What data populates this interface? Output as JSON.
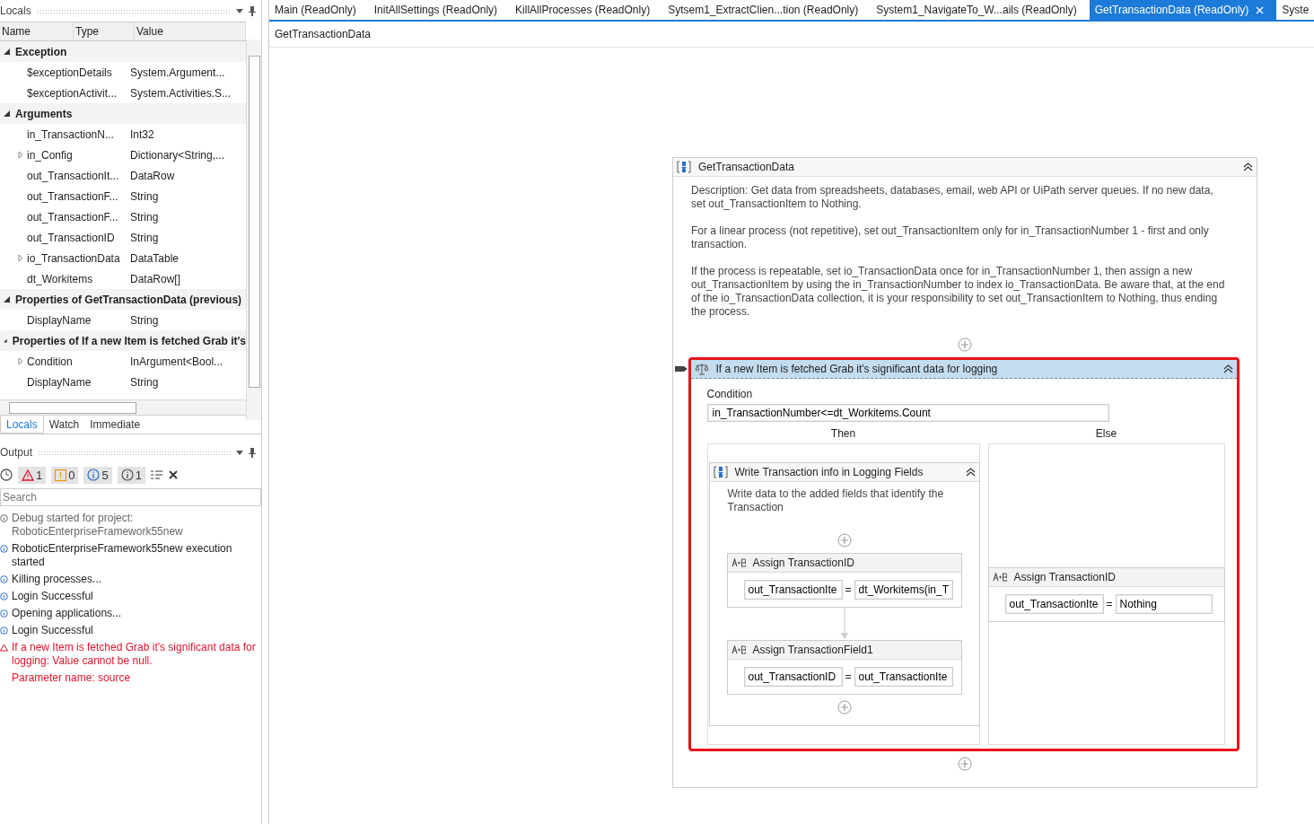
{
  "locals": {
    "title": "Locals",
    "columns": [
      "Name",
      "Type",
      "Value"
    ],
    "rows": [
      {
        "kind": "group",
        "label": "Exception",
        "expanded": true
      },
      {
        "kind": "item",
        "name": "$exceptionDetails",
        "value": "System.Argument..."
      },
      {
        "kind": "item",
        "name": "$exceptionActivit...",
        "value": "System.Activities.S..."
      },
      {
        "kind": "group",
        "label": "Arguments",
        "expanded": true
      },
      {
        "kind": "item",
        "name": "in_TransactionN...",
        "value": "Int32"
      },
      {
        "kind": "item",
        "name": "in_Config",
        "value": "Dictionary<String,...",
        "expanded": false
      },
      {
        "kind": "item",
        "name": "out_TransactionIt...",
        "value": "DataRow"
      },
      {
        "kind": "item",
        "name": "out_TransactionF...",
        "value": "String"
      },
      {
        "kind": "item",
        "name": "out_TransactionF...",
        "value": "String"
      },
      {
        "kind": "item",
        "name": "out_TransactionID",
        "value": "String"
      },
      {
        "kind": "item",
        "name": "io_TransactionData",
        "value": "DataTable",
        "expanded": false
      },
      {
        "kind": "item",
        "name": "dt_Workitems",
        "value": "DataRow[]"
      },
      {
        "kind": "group",
        "label": "Properties of GetTransactionData (previous)",
        "expanded": true
      },
      {
        "kind": "item",
        "name": "DisplayName",
        "value": "String"
      },
      {
        "kind": "group",
        "label": "Properties of If a new Item is fetched Grab it's",
        "expanded": true
      },
      {
        "kind": "item",
        "name": "Condition",
        "value": "InArgument<Bool...",
        "expanded": false
      },
      {
        "kind": "item",
        "name": "DisplayName",
        "value": "String"
      }
    ],
    "tabs": [
      {
        "label": "Locals",
        "selected": true
      },
      {
        "label": "Watch",
        "selected": false
      },
      {
        "label": "Immediate",
        "selected": false
      }
    ]
  },
  "output": {
    "title": "Output",
    "filters": [
      {
        "kind": "error",
        "count": "1",
        "selected": true
      },
      {
        "kind": "warning",
        "count": "0",
        "selected": true
      },
      {
        "kind": "info",
        "count": "5",
        "selected": true
      },
      {
        "kind": "trace",
        "count": "1",
        "selected": true
      }
    ],
    "search": {
      "placeholder": "Search"
    },
    "entries": [
      {
        "kind": "trace",
        "text": "Debug started for project: RoboticEnterpriseFramework55new"
      },
      {
        "kind": "info",
        "text": "RoboticEnterpriseFramework55new execution started"
      },
      {
        "kind": "info",
        "text": "Killing processes..."
      },
      {
        "kind": "info",
        "text": "Login Successful"
      },
      {
        "kind": "info",
        "text": "Opening applications..."
      },
      {
        "kind": "info",
        "text": "Login Successful"
      },
      {
        "kind": "error",
        "text": "If a new Item is fetched Grab it's significant data for logging: Value cannot be null.",
        "detail": "Parameter name: source"
      }
    ]
  },
  "doc_tabs": [
    {
      "label": "Main (ReadOnly)",
      "selected": false
    },
    {
      "label": "InitAllSettings (ReadOnly)",
      "selected": false
    },
    {
      "label": "KillAllProcesses (ReadOnly)",
      "selected": false
    },
    {
      "label": "Sytsem1_ExtractClien...tion (ReadOnly)",
      "selected": false
    },
    {
      "label": "System1_NavigateTo_W...ails (ReadOnly)",
      "selected": false
    },
    {
      "label": "GetTransactionData (ReadOnly)",
      "selected": true
    },
    {
      "label": "Syste",
      "selected": false
    }
  ],
  "breadcrumb": "GetTransactionData",
  "sequence": {
    "title": "GetTransactionData",
    "expanded": true,
    "description": [
      "Description: Get data from spreadsheets, databases, email, web API or UiPath server queues. If no new data, set out_TransactionItem to Nothing.",
      "For a linear process (not repetitive), set out_TransactionItem only for in_TransactionNumber 1 - first and only transaction.",
      "If the process is repeatable, set io_TransactionData once for in_TransactionNumber 1, then assign a new out_TransactionItem by using the in_TransactionNumber to index io_TransactionData. Be aware that, at the end of the io_TransactionData collection, it is your responsibility to set out_TransactionItem to Nothing, thus ending the process."
    ],
    "if": {
      "title": "If a new Item is fetched Grab it's significant data for logging",
      "selected": true,
      "condition_label": "Condition",
      "condition": "in_TransactionNumber<=dt_Workitems.Count",
      "then_label": "Then",
      "else_label": "Else",
      "then": {
        "title": "Write Transaction info in Logging Fields",
        "expanded": true,
        "description": "Write data to the added fields that identify the Transaction",
        "assigns": [
          {
            "title": "Assign TransactionID",
            "to": "out_TransactionIte",
            "operator": "=",
            "value": "dt_Workitems(in_T"
          },
          {
            "title": "Assign TransactionField1",
            "to": "out_TransactionID",
            "operator": "=",
            "value": "out_TransactionIte"
          }
        ]
      },
      "else": {
        "title": "Assign TransactionID",
        "to": "out_TransactionIte",
        "operator": "=",
        "value": "Nothing"
      }
    }
  }
}
